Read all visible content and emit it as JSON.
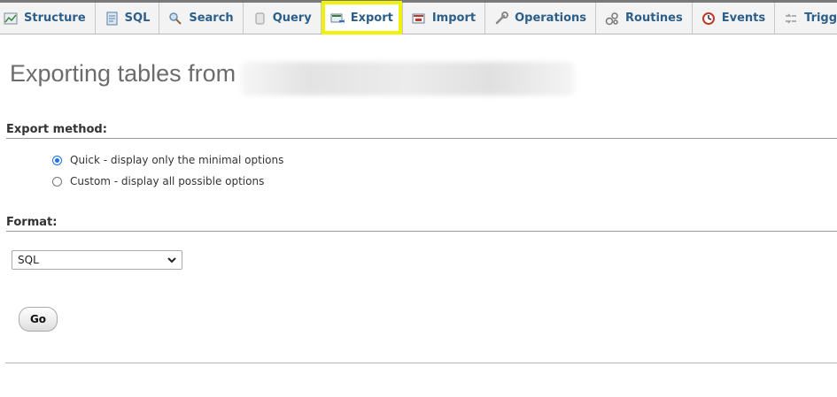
{
  "tabs": [
    {
      "label": "Structure",
      "icon": "structure-icon"
    },
    {
      "label": "SQL",
      "icon": "sql-icon"
    },
    {
      "label": "Search",
      "icon": "search-icon"
    },
    {
      "label": "Query",
      "icon": "query-icon"
    },
    {
      "label": "Export",
      "icon": "export-icon",
      "active": true
    },
    {
      "label": "Import",
      "icon": "import-icon"
    },
    {
      "label": "Operations",
      "icon": "wrench-icon"
    },
    {
      "label": "Routines",
      "icon": "routines-icon"
    },
    {
      "label": "Events",
      "icon": "clock-icon"
    },
    {
      "label": "Triggers",
      "icon": "triggers-icon"
    }
  ],
  "page": {
    "title": "Exporting tables from"
  },
  "export_method": {
    "heading": "Export method:",
    "options": [
      {
        "label": "Quick - display only the minimal options",
        "checked": true
      },
      {
        "label": "Custom - display all possible options",
        "checked": false
      }
    ]
  },
  "format": {
    "heading": "Format:",
    "selected": "SQL"
  },
  "actions": {
    "go_label": "Go"
  },
  "colors": {
    "tab_text": "#2b5f8a",
    "highlight": "#eef20a",
    "radio_accent": "#1a73e8"
  }
}
